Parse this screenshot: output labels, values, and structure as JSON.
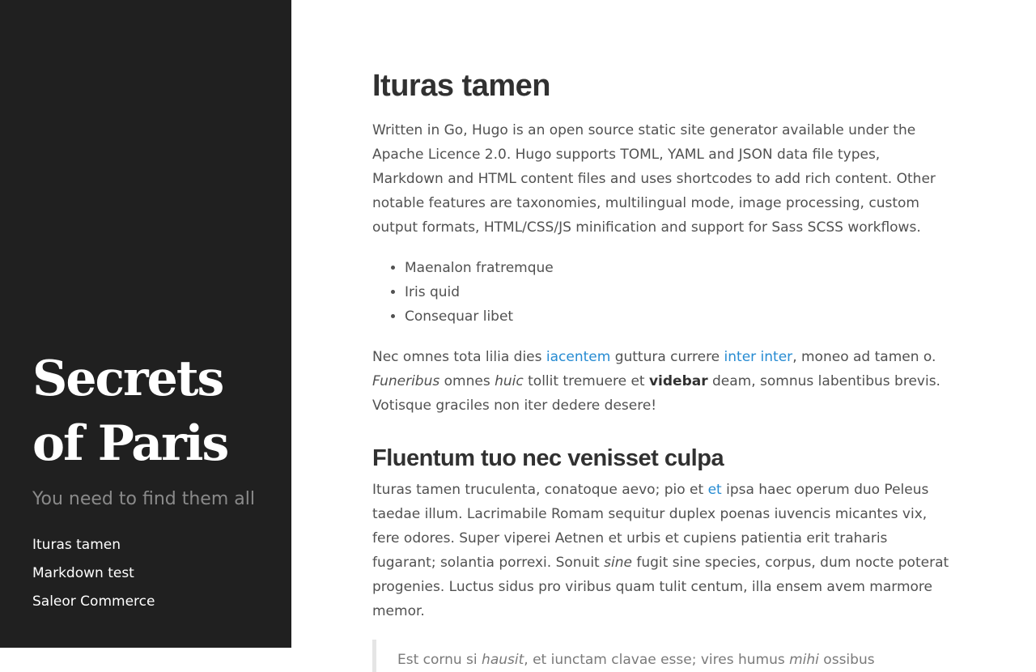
{
  "sidebar": {
    "title_line1": "Secrets",
    "title_line2": "of Paris",
    "tagline": "You need to find them all",
    "nav": [
      {
        "label": "Ituras tamen"
      },
      {
        "label": "Markdown test"
      },
      {
        "label": "Saleor Commerce"
      }
    ]
  },
  "article": {
    "heading": "Ituras tamen",
    "intro": "Written in Go, Hugo is an open source static site generator available under the Apache Licence 2.0. Hugo supports TOML, YAML and JSON data file types, Markdown and HTML content files and uses shortcodes to add rich content. Other notable features are taxonomies, multilingual mode, image processing, custom output formats, HTML/CSS/JS minification and support for Sass SCSS workflows.",
    "list": [
      "Maenalon fratremque",
      "Iris quid",
      "Consequar libet"
    ],
    "p2": {
      "t1": "Nec omnes tota lilia dies ",
      "link1": "iacentem",
      "t2": " guttura currere ",
      "link2": "inter inter",
      "t3": ", moneo ad tamen o. ",
      "em1": "Funeribus",
      "t4": " omnes ",
      "em2": "huic",
      "t5": " tollit tremuere et ",
      "strong1": "videbar",
      "t6": " deam, somnus labentibus brevis. Votisque graciles non iter dedere desere!"
    },
    "heading2": "Fluentum tuo nec venisset culpa",
    "p3": {
      "t1": "Ituras tamen truculenta, conatoque aevo; pio et ",
      "link1": "et",
      "t2": " ipsa haec operum duo Peleus taedae illum. Lacrimabile Romam sequitur duplex poenas iuvencis micantes vix, fere odores. Super viperei Aetnen et urbis et cupiens patientia erit traharis fugarant; solantia porrexi. Sonuit ",
      "em1": "sine",
      "t3": " fugit sine species, corpus, dum nocte poterat progenies. Luctus sidus pro viribus quam tulit centum, illa ensem avem marmore memor."
    },
    "quote": {
      "t1": "Est cornu si ",
      "em1": "hausit",
      "t2": ", et iunctam clavae esse; vires humus ",
      "em2": "mihi",
      "t3": " ossibus"
    }
  }
}
